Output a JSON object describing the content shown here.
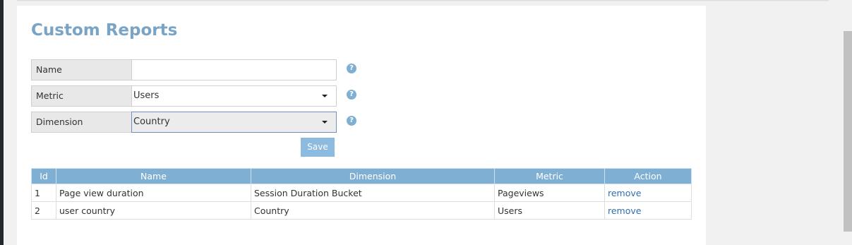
{
  "page": {
    "title": "Custom Reports"
  },
  "form": {
    "name": {
      "label": "Name",
      "value": ""
    },
    "metric": {
      "label": "Metric",
      "value": "Users"
    },
    "dimension": {
      "label": "Dimension",
      "value": "Country"
    },
    "help_glyph": "?",
    "save_label": "Save"
  },
  "table": {
    "headers": [
      "Id",
      "Name",
      "Dimension",
      "Metric",
      "Action"
    ],
    "rows": [
      {
        "id": "1",
        "name": "Page view duration",
        "dimension": "Session Duration Bucket",
        "metric": "Pageviews",
        "action": "remove"
      },
      {
        "id": "2",
        "name": "user country",
        "dimension": "Country",
        "metric": "Users",
        "action": "remove"
      }
    ]
  },
  "colors": {
    "accent": "#7fb0d4",
    "title": "#79a4c5",
    "link": "#2f6fb0"
  }
}
